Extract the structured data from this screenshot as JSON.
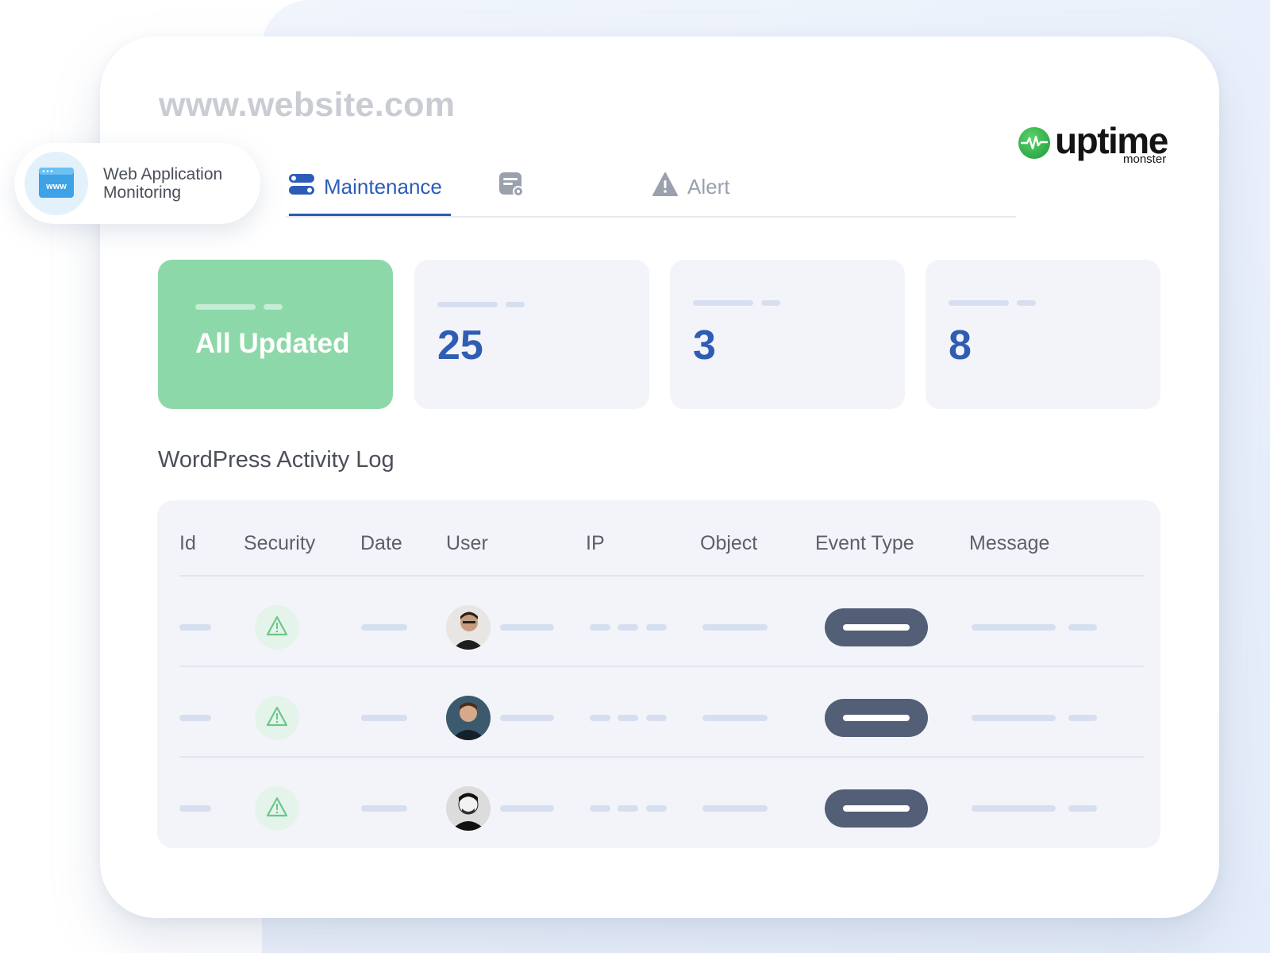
{
  "site": {
    "url": "www.website.com"
  },
  "brand": {
    "word": "uptime",
    "sub": "monster",
    "accent": "#2ea84a"
  },
  "badge": {
    "label": "Web Application Monitoring",
    "icon": "www-browser-icon"
  },
  "tabs": [
    {
      "label": "Maintenance",
      "icon": "toggles-icon",
      "active": true
    },
    {
      "label": "",
      "icon": "server-icon",
      "active": false
    },
    {
      "label": "Alert",
      "icon": "warning-icon",
      "active": false
    }
  ],
  "stats": [
    {
      "value": "All Updated",
      "color": "#8dd8a9"
    },
    {
      "value": "25"
    },
    {
      "value": "3"
    },
    {
      "value": "8"
    }
  ],
  "activity_log": {
    "title": "WordPress Activity Log",
    "columns": [
      "Id",
      "Security",
      "Date",
      "User",
      "IP",
      "Object",
      "Event Type",
      "Message"
    ],
    "rows": [
      {
        "security_icon": "warning-icon",
        "avatar": "user-avatar-1"
      },
      {
        "security_icon": "warning-icon",
        "avatar": "user-avatar-2"
      },
      {
        "security_icon": "warning-icon",
        "avatar": "user-avatar-3"
      }
    ]
  },
  "colors": {
    "primary": "#2d5cb8",
    "muted_text": "#9aa1ad",
    "event_pill": "#525f76",
    "placeholder_bar": "#d6dff0"
  }
}
